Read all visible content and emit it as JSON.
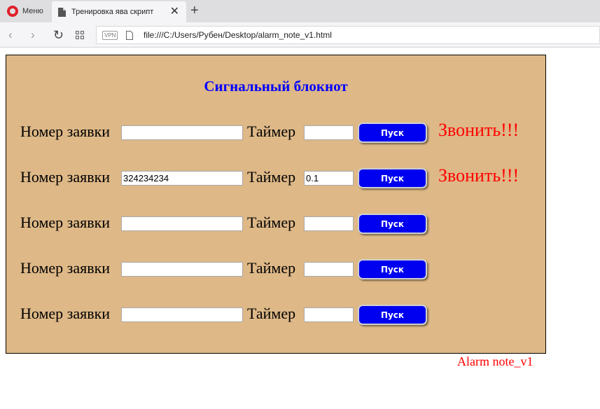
{
  "browser": {
    "menu_label": "Меню",
    "tab_title": "Тренировка ява скрипт",
    "close_glyph": "✕",
    "new_tab_glyph": "+",
    "back_glyph": "‹",
    "forward_glyph": "›",
    "reload_glyph": "↻",
    "vpn_label": "VPN",
    "url": "file:///C:/Users/Рубен/Desktop/alarm_note_v1.html"
  },
  "page": {
    "title": "Сигнальный блокнот",
    "background_color": "#DEB887",
    "title_color": "#0000FF",
    "alarm_color": "#FF0000",
    "footer_note": "Alarm note_v1",
    "rows": [
      {
        "number_label": "Номер заявки",
        "number_value": "",
        "timer_label": "Таймер",
        "timer_value": "",
        "button_label": "Пуск",
        "alarm_text": "Звонить!!!"
      },
      {
        "number_label": "Номер заявки",
        "number_value": "324234234",
        "timer_label": "Таймер",
        "timer_value": "0.1",
        "button_label": "Пуск",
        "alarm_text": "Звонить!!!"
      },
      {
        "number_label": "Номер заявки",
        "number_value": "",
        "timer_label": "Таймер",
        "timer_value": "",
        "button_label": "Пуск",
        "alarm_text": ""
      },
      {
        "number_label": "Номер заявки",
        "number_value": "",
        "timer_label": "Таймер",
        "timer_value": "",
        "button_label": "Пуск",
        "alarm_text": ""
      },
      {
        "number_label": "Номер заявки",
        "number_value": "",
        "timer_label": "Таймер",
        "timer_value": "",
        "button_label": "Пуск",
        "alarm_text": ""
      }
    ]
  }
}
